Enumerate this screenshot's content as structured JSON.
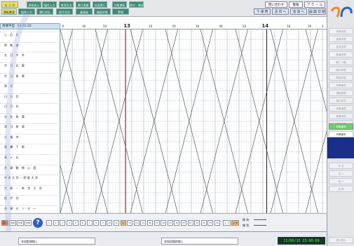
{
  "menu": {
    "row1": [
      {
        "label": "モ ニ タ",
        "active": true
      },
      {
        "label": "原紙表示",
        "active": false
      },
      {
        "label": "臨時入力",
        "active": false
      },
      {
        "label": "運用状況",
        "active": false
      },
      {
        "label": "運行実績",
        "active": false
      },
      {
        "label": "計画実行",
        "active": false
      },
      {
        "label": "列車運転",
        "active": false
      },
      {
        "label": "保守・障害",
        "active": false
      }
    ],
    "row2": [
      {
        "label": "運転整理",
        "active": true
      },
      {
        "label": "臨時入力",
        "active": false
      },
      {
        "label": "運行状況",
        "active": false
      },
      {
        "label": "指令状況",
        "active": false
      },
      {
        "label": "乗務員",
        "active": false
      },
      {
        "label": "機器状態",
        "active": false
      },
      {
        "label": "警報",
        "active": false
      }
    ],
    "right_row1": [
      "問い合わせ",
      "警報",
      "ア ラ ー ム"
    ],
    "right_row2": [
      "下 運 用",
      "支 伝 へ",
      "会 話 へ",
      "画 面 切 替"
    ]
  },
  "train_label": {
    "name": "南幡平型",
    "time": "13:01:20"
  },
  "time_axis": {
    "ticks": [
      {
        "label": "0",
        "pos": 0.0,
        "major": false
      },
      {
        "label": "40",
        "pos": 0.08,
        "major": false
      },
      {
        "label": "50",
        "pos": 0.16,
        "major": false
      },
      {
        "label": "13",
        "pos": 0.245,
        "major": true
      },
      {
        "label": "10",
        "pos": 0.335,
        "major": false
      },
      {
        "label": "20",
        "pos": 0.425,
        "major": false
      },
      {
        "label": "30",
        "pos": 0.515,
        "major": false
      },
      {
        "label": "40",
        "pos": 0.605,
        "major": false
      },
      {
        "label": "50",
        "pos": 0.695,
        "major": false
      },
      {
        "label": "14",
        "pos": 0.775,
        "major": true
      },
      {
        "label": "10",
        "pos": 0.865,
        "major": false
      },
      {
        "label": "20",
        "pos": 0.945,
        "major": false
      },
      {
        "label": "3",
        "pos": 0.995,
        "major": false
      }
    ],
    "current_time_pos": 0.245
  },
  "stations": [
    "上 石 台",
    "弥 勒 者",
    "五 日 ネ 木",
    "竹 日 北 電",
    "竹 日 前 電",
    "高 北",
    "日 日 北",
    "日 日 北",
    "谷 在 前 電",
    "津 日 前 道",
    "大 福 寺",
    "高 橋 下 駅",
    "高 ヶ 丘",
    "多 摩 動 物 公 園",
    "中央大学・明星大学",
    "大 塚 ・ 帝 京 大 学",
    "松 が 谷",
    "多 摩 セ ン タ ー"
  ],
  "toolbar": {
    "buttons": [
      "表示",
      "列車",
      "列車",
      "列車"
    ],
    "help_icon": "question-icon",
    "pages": [
      "1",
      "2",
      "3",
      "4",
      "5",
      "6",
      "7",
      "8",
      "9",
      "10",
      "11",
      "12",
      "13",
      "14",
      "15",
      "16",
      "17",
      "18",
      "19",
      "20",
      "21",
      "22",
      "23",
      "24",
      "25",
      "26"
    ],
    "selected_page": "12",
    "right_buttons": [
      "上 下",
      "全 体"
    ],
    "legend": [
      {
        "label": "線 別",
        "colors": [
          "#3a4fd0",
          "#3a4fd0"
        ]
      },
      {
        "label": "線 別",
        "colors": [
          "#3a4fd0",
          "#3a4fd0"
        ]
      }
    ]
  },
  "status": {
    "left": "本局監視無し",
    "center": "本局回復則無し",
    "clock": "11/06/15 13:00:00"
  },
  "right_panel": {
    "buttons": [
      "列車状態",
      "進路状態",
      "信号状態",
      "軌道状態",
      "転てつ器",
      "踏切状態",
      "駅扱状態",
      "列車番号",
      "運転整理",
      "運行状況",
      "列車追跡",
      "発着時刻",
      "自動進路"
    ],
    "green_label": "列車番号",
    "white_label": "列車番号",
    "gray_labels": [
      "戻 る",
      "次 へ",
      "前 へ",
      "全 体"
    ],
    "bottom_label": "発行表示",
    "accent_colors": {
      "green": "#7ac86c",
      "navy": "#1a2f8a",
      "logo_orange": "#f08a20",
      "logo_blue": "#2c62c8"
    }
  }
}
